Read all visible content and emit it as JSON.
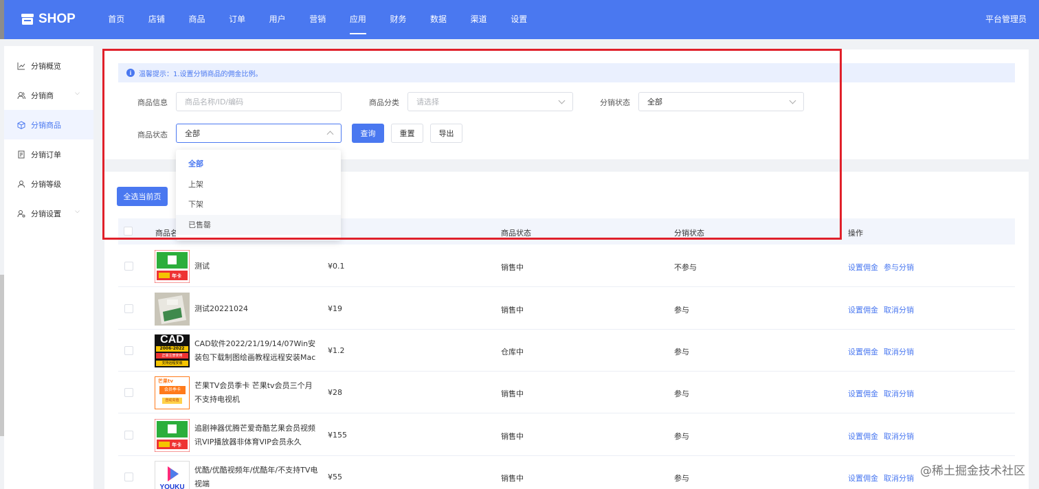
{
  "header": {
    "logo_text": "SHOP",
    "nav": [
      "首页",
      "店铺",
      "商品",
      "订单",
      "用户",
      "营销",
      "应用",
      "财务",
      "数据",
      "渠道",
      "设置"
    ],
    "active_nav": "应用",
    "admin_label": "平台管理员",
    "brand_color": "#4a78f0"
  },
  "sidebar": {
    "items": [
      {
        "label": "分销概览",
        "icon": "chart-line-icon"
      },
      {
        "label": "分销商",
        "icon": "users-icon",
        "has_submenu": true
      },
      {
        "label": "分销商品",
        "icon": "box-icon",
        "active": true
      },
      {
        "label": "分销订单",
        "icon": "document-icon"
      },
      {
        "label": "分销等级",
        "icon": "user-level-icon"
      },
      {
        "label": "分销设置",
        "icon": "user-settings-icon",
        "has_submenu": true
      }
    ]
  },
  "notice": {
    "text": "温馨提示：1.设置分销商品的佣金比例。"
  },
  "filters": {
    "product_info": {
      "label": "商品信息",
      "placeholder": "商品名称/ID/编码"
    },
    "product_category": {
      "label": "商品分类",
      "placeholder": "请选择"
    },
    "distribution_status": {
      "label": "分销状态",
      "value": "全部"
    },
    "product_status": {
      "label": "商品状态",
      "value": "全部"
    },
    "query_label": "查询",
    "reset_label": "重置",
    "export_label": "导出"
  },
  "status_dropdown": {
    "options": [
      "全部",
      "上架",
      "下架",
      "已售罄"
    ],
    "selected": "全部",
    "hovered": "已售罄"
  },
  "select_page_label": "全选当前页",
  "table": {
    "headers": {
      "name": "商品名",
      "product_status": "商品状态",
      "dist_status": "分销状态",
      "actions": "操作"
    },
    "rows": [
      {
        "name": "测试",
        "price": "¥0.1",
        "status": "销售中",
        "dist": "不参与",
        "action1": "设置佣金",
        "action2": "参与分销",
        "thumb": "vip-card-thumb"
      },
      {
        "name": "测试20221024",
        "price": "¥19",
        "status": "销售中",
        "dist": "参与",
        "action1": "设置佣金",
        "action2": "取消分销",
        "thumb": "package-photo-thumb"
      },
      {
        "name": "CAD软件2022/21/19/14/07Win安装包下载制图绘画教程远程安装Mac",
        "price": "¥1.2",
        "status": "仓库中",
        "dist": "参与",
        "action1": "设置佣金",
        "action2": "取消分销",
        "thumb": "cad-thumb"
      },
      {
        "name": "芒果TV会员季卡 芒果tv会员三个月 不支持电视机",
        "price": "¥28",
        "status": "销售中",
        "dist": "参与",
        "action1": "设置佣金",
        "action2": "取消分销",
        "thumb": "mango-tv-thumb"
      },
      {
        "name": "追剧神器优腾芒爱奇酷艺果会员视频讯VIP播放器非体育VIP会员永久",
        "price": "¥155",
        "status": "销售中",
        "dist": "参与",
        "action1": "设置佣金",
        "action2": "取消分销",
        "thumb": "vip-card-thumb"
      },
      {
        "name": "优酷/优酷视频年/优酷年/不支持TV电视端",
        "price": "¥55",
        "status": "销售中",
        "dist": "参与",
        "action1": "设置佣金",
        "action2": "取消分销",
        "thumb": "youku-thumb"
      }
    ]
  },
  "thumb_text": {
    "vip_badge": "年卡",
    "cad": "CAD",
    "cad_years": "2006-2022",
    "cad_sub": "正版注册使用",
    "cad_bottom": "支持远程安装",
    "mango": "芒果tv",
    "mango_sub": "会员季卡",
    "mango_auto": "自动充值",
    "youku": "YOUKU"
  },
  "watermark": "@稀土掘金技术社区"
}
